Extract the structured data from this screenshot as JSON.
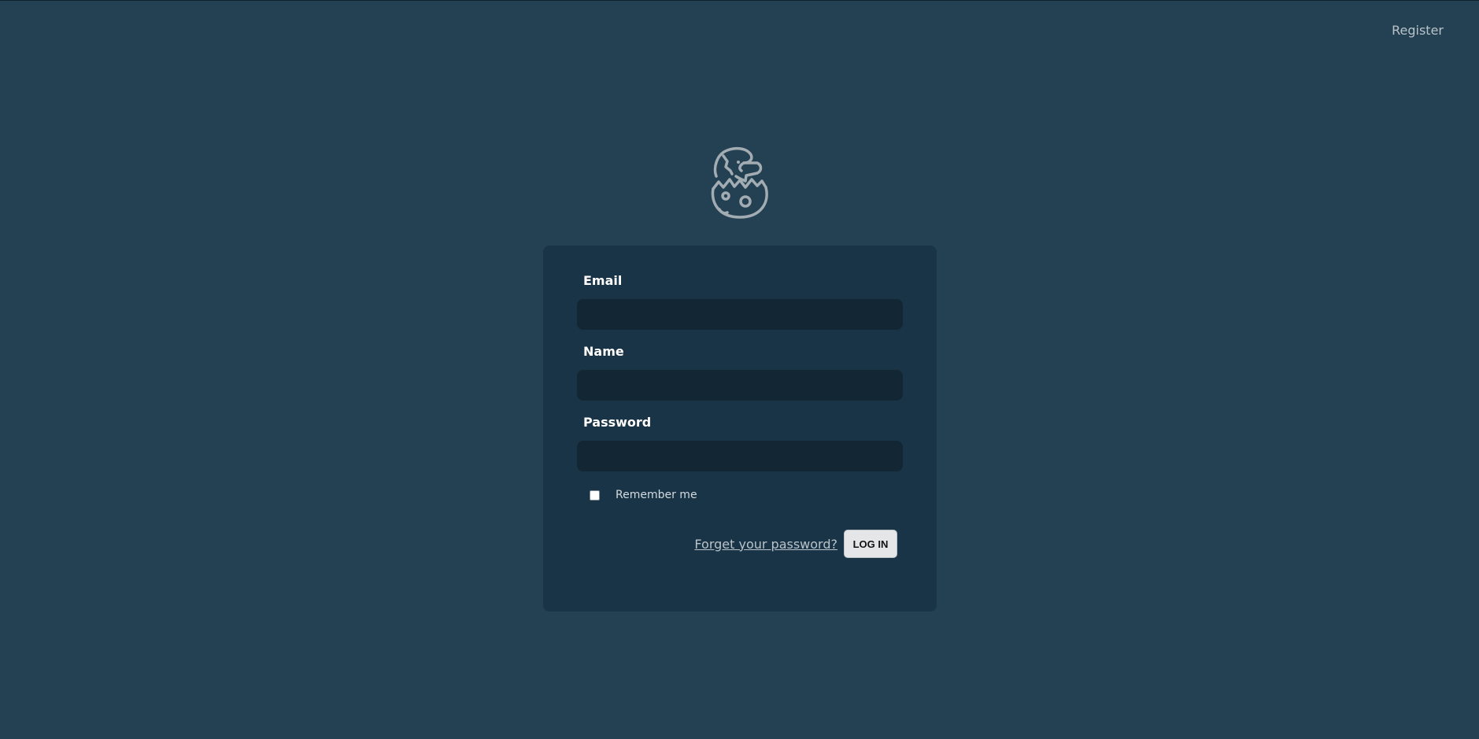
{
  "header": {
    "register_label": "Register"
  },
  "logo": {
    "icon": "hatching-dinosaur-egg-icon"
  },
  "form": {
    "email_label": "Email",
    "email_value": "",
    "name_label": "Name",
    "name_value": "",
    "password_label": "Password",
    "password_value": "",
    "remember_label": "Remember me",
    "remember_checked": false,
    "forgot_label": "Forget your password?",
    "login_label": "LOG IN"
  },
  "colors": {
    "background": "#234153",
    "card": "#193446",
    "input": "#132633",
    "button": "#e4e6e8"
  }
}
